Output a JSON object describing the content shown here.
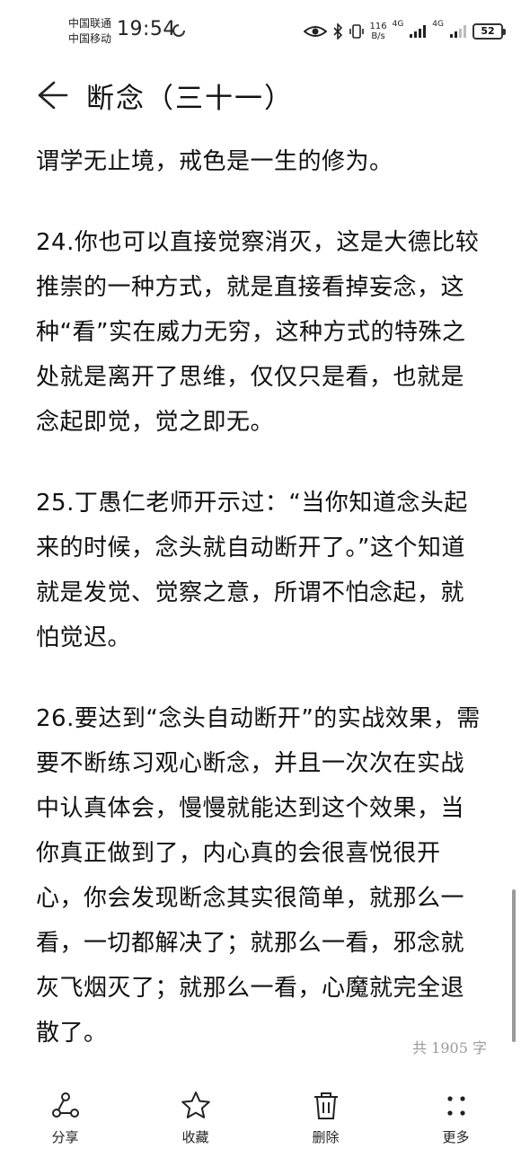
{
  "status_bar": {
    "carrier_1": "中国联通",
    "carrier_2": "中国移动",
    "time": "19:54",
    "net_speed_value": "116",
    "net_speed_unit": "B/s",
    "network_1": "4G",
    "network_2": "4G",
    "battery": "52"
  },
  "header": {
    "title": "断念（三十一）"
  },
  "article": {
    "paragraphs": [
      "谓学无止境，戒色是一生的修为。",
      "24.你也可以直接觉察消灭，这是大德比较推崇的一种方式，就是直接看掉妄念，这种“看”实在威力无穷，这种方式的特殊之处就是离开了思维，仅仅只是看，也就是念起即觉，觉之即无。",
      "25.丁愚仁老师开示过：“当你知道念头起来的时候，念头就自动断开了。”这个知道就是发觉、觉察之意，所谓不怕念起，就怕觉迟。",
      "26.要达到“念头自动断开”的实战效果，需要不断练习观心断念，并且一次次在实战中认真体会，慢慢就能达到这个效果，当你真正做到了，内心真的会很喜悦很开心，你会发现断念其实很简单，就那么一看，一切都解决了；就那么一看，邪念就灰飞烟灭了；就那么一看，心魔就完全退散了。"
    ],
    "word_count": "共 1905 字"
  },
  "toolbar": {
    "share": "分享",
    "favorite": "收藏",
    "delete": "删除",
    "more": "更多"
  }
}
